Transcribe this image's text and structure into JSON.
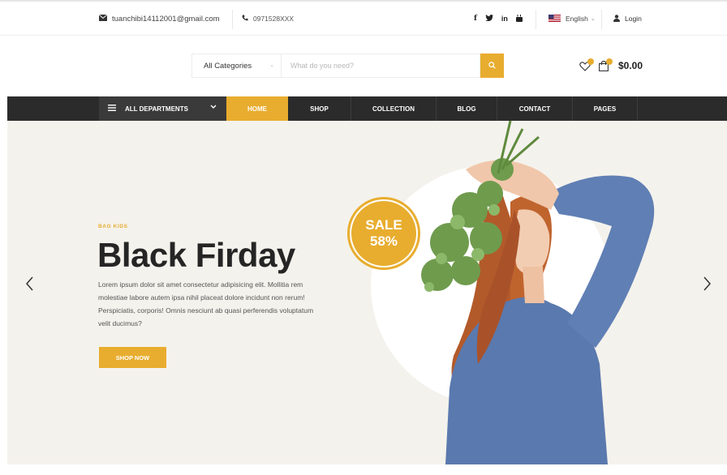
{
  "topbar": {
    "email": "tuanchibi14112001@gmail.com",
    "phone": "0971528XXX",
    "social": [
      "f",
      "t",
      "in",
      "yt"
    ],
    "language": "English",
    "login": "Login"
  },
  "search": {
    "category": "All Categories",
    "placeholder": "What do you need?"
  },
  "cart": {
    "total": "$0.00"
  },
  "nav": {
    "departments": "ALL DEPARTMENTS",
    "items": [
      "HOME",
      "SHOP",
      "COLLECTION",
      "BLOG",
      "CONTACT",
      "PAGES"
    ],
    "active_index": 0
  },
  "hero": {
    "sub_label": "BAG KIDS",
    "title": "Black Firday",
    "description": "Lorem ipsum dolor sit amet consectetur adipisicing elit. Mollitia rem molestiae labore autem ipsa nihil placeat dolore incidunt non rerum! Perspiciatis, corporis! Omnis nesciunt ab quasi perferendis voluptatum velit ducimus?",
    "button": "SHOP NOW",
    "sale_line1": "SALE",
    "sale_line2": "58%"
  },
  "colors": {
    "accent": "#e8ad2f",
    "nav_bg": "#2b2b2b",
    "hero_bg": "#f4f2ec"
  },
  "icons": [
    "envelope-icon",
    "phone-icon",
    "facebook-icon",
    "twitter-icon",
    "linkedin-icon",
    "youtube-icon",
    "us-flag-icon",
    "user-icon",
    "search-icon",
    "heart-icon",
    "bag-icon",
    "menu-icon",
    "chevron-left-icon",
    "chevron-right-icon"
  ]
}
